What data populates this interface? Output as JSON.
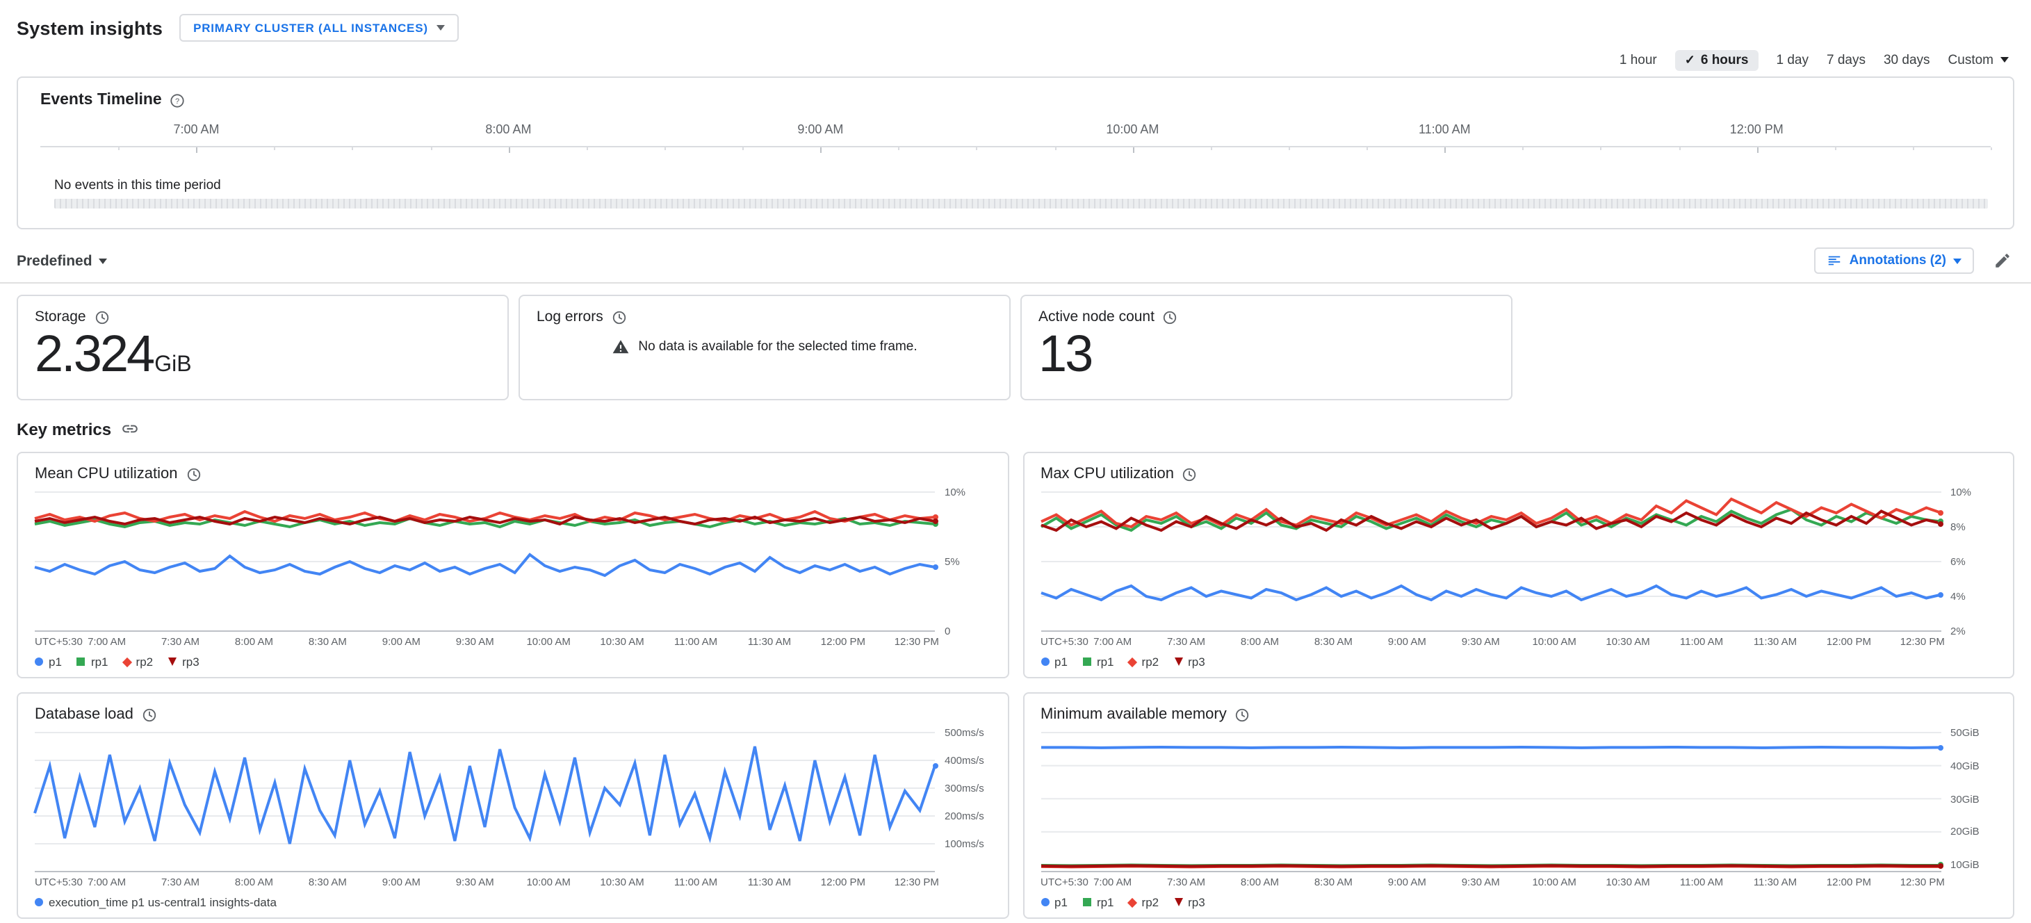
{
  "header": {
    "title": "System insights",
    "scope_button_label": "PRIMARY CLUSTER (ALL INSTANCES)"
  },
  "time_range": {
    "options": [
      {
        "label": "1 hour",
        "selected": false
      },
      {
        "label": "6 hours",
        "selected": true
      },
      {
        "label": "1 day",
        "selected": false
      },
      {
        "label": "7 days",
        "selected": false
      },
      {
        "label": "30 days",
        "selected": false
      }
    ],
    "custom_label": "Custom"
  },
  "icons": {
    "check": "✓",
    "help": "?"
  },
  "events_timeline": {
    "title": "Events Timeline",
    "hours": [
      "7:00 AM",
      "8:00 AM",
      "9:00 AM",
      "10:00 AM",
      "11:00 AM",
      "12:00 PM"
    ],
    "empty_message": "No events in this time period"
  },
  "toolbar": {
    "predefined_label": "Predefined",
    "annotations_label": "Annotations (2)"
  },
  "summary_cards": {
    "storage": {
      "title": "Storage",
      "value": "2.324",
      "unit": "GiB"
    },
    "log_errors": {
      "title": "Log errors",
      "message": "No data is available for the selected time frame."
    },
    "active_nodes": {
      "title": "Active node count",
      "value": "13"
    }
  },
  "key_metrics_title": "Key metrics",
  "xlabels": [
    "UTC+5:30",
    "7:00 AM",
    "7:30 AM",
    "8:00 AM",
    "8:30 AM",
    "9:00 AM",
    "9:30 AM",
    "10:00 AM",
    "10:30 AM",
    "11:00 AM",
    "11:30 AM",
    "12:00 PM",
    "12:30 PM"
  ],
  "charts": [
    {
      "title": "Mean CPU utilization",
      "type": "line",
      "ylim": [
        0,
        10
      ],
      "yticks": [
        {
          "value": 10,
          "label": "10%"
        },
        {
          "value": 5,
          "label": "5%"
        },
        {
          "value": 0,
          "label": "0"
        }
      ],
      "series": [
        {
          "name": "p1",
          "color": "#4285f4",
          "marker": "circle",
          "values": [
            4.6,
            4.3,
            4.8,
            4.4,
            4.1,
            4.7,
            5.0,
            4.4,
            4.2,
            4.6,
            4.9,
            4.3,
            4.5,
            5.4,
            4.6,
            4.2,
            4.4,
            4.8,
            4.3,
            4.1,
            4.6,
            5.0,
            4.5,
            4.2,
            4.7,
            4.4,
            4.9,
            4.3,
            4.6,
            4.1,
            4.5,
            4.8,
            4.2,
            5.5,
            4.7,
            4.3,
            4.6,
            4.4,
            4.0,
            4.7,
            5.1,
            4.4,
            4.2,
            4.8,
            4.5,
            4.1,
            4.6,
            4.9,
            4.3,
            5.3,
            4.6,
            4.2,
            4.7,
            4.4,
            4.8,
            4.3,
            4.6,
            4.1,
            4.5,
            4.8,
            4.6
          ]
        },
        {
          "name": "rp1",
          "color": "#34a853",
          "marker": "square",
          "values": [
            7.7,
            7.9,
            7.6,
            7.8,
            8.0,
            7.7,
            7.5,
            7.8,
            7.9,
            7.6,
            7.8,
            7.7,
            8.0,
            7.8,
            7.6,
            7.9,
            7.7,
            7.5,
            7.8,
            8.0,
            7.7,
            7.9,
            7.6,
            7.8,
            7.7,
            8.1,
            7.8,
            7.6,
            7.9,
            7.7,
            7.8,
            7.5,
            7.9,
            7.7,
            8.0,
            7.8,
            7.6,
            7.9,
            7.7,
            7.8,
            8.0,
            7.6,
            7.8,
            7.9,
            7.7,
            7.5,
            7.8,
            8.0,
            7.7,
            7.9,
            7.6,
            7.8,
            7.7,
            7.9,
            8.1,
            7.7,
            7.8,
            7.6,
            7.9,
            7.8,
            7.7
          ]
        },
        {
          "name": "rp2",
          "color": "#ea4335",
          "marker": "diamond",
          "values": [
            8.1,
            8.4,
            8.0,
            8.2,
            7.9,
            8.3,
            8.5,
            8.1,
            7.9,
            8.2,
            8.4,
            8.0,
            8.3,
            8.1,
            8.6,
            8.2,
            7.9,
            8.3,
            8.1,
            8.4,
            8.0,
            8.2,
            8.5,
            8.1,
            7.9,
            8.3,
            8.0,
            8.4,
            8.2,
            7.9,
            8.1,
            8.5,
            8.2,
            8.0,
            8.3,
            8.1,
            8.4,
            7.9,
            8.2,
            8.0,
            8.5,
            8.3,
            8.0,
            8.2,
            8.4,
            8.1,
            7.9,
            8.3,
            8.1,
            8.4,
            8.0,
            8.2,
            8.6,
            8.1,
            7.9,
            8.2,
            8.4,
            8.0,
            8.3,
            8.1,
            8.2
          ]
        },
        {
          "name": "rp3",
          "color": "#a50e0e",
          "marker": "triangle",
          "values": [
            7.9,
            8.1,
            7.8,
            8.0,
            8.2,
            7.9,
            7.7,
            8.0,
            8.1,
            7.8,
            8.0,
            8.2,
            7.9,
            7.7,
            8.1,
            7.9,
            8.2,
            8.0,
            7.8,
            8.1,
            7.9,
            7.7,
            8.0,
            8.2,
            7.9,
            8.1,
            7.8,
            8.0,
            7.9,
            8.2,
            8.0,
            7.8,
            8.1,
            7.9,
            8.0,
            7.7,
            8.2,
            8.0,
            7.9,
            8.1,
            7.8,
            8.0,
            8.2,
            7.9,
            7.7,
            8.0,
            8.1,
            7.9,
            8.2,
            7.8,
            8.0,
            7.9,
            8.1,
            7.8,
            8.0,
            8.2,
            7.9,
            8.0,
            7.8,
            8.1,
            7.9
          ]
        }
      ]
    },
    {
      "title": "Max CPU utilization",
      "type": "line",
      "ylim": [
        2,
        10
      ],
      "yticks": [
        {
          "value": 10,
          "label": "10%"
        },
        {
          "value": 8,
          "label": "8%"
        },
        {
          "value": 6,
          "label": "6%"
        },
        {
          "value": 4,
          "label": "4%"
        },
        {
          "value": 2,
          "label": "2%"
        }
      ],
      "series": [
        {
          "name": "p1",
          "color": "#4285f4",
          "marker": "circle",
          "values": [
            4.2,
            3.9,
            4.4,
            4.1,
            3.8,
            4.3,
            4.6,
            4.0,
            3.8,
            4.2,
            4.5,
            4.0,
            4.3,
            4.1,
            3.9,
            4.4,
            4.2,
            3.8,
            4.1,
            4.5,
            4.0,
            4.3,
            3.9,
            4.2,
            4.6,
            4.1,
            3.8,
            4.3,
            4.0,
            4.4,
            4.1,
            3.9,
            4.5,
            4.2,
            4.0,
            4.3,
            3.8,
            4.1,
            4.4,
            4.0,
            4.2,
            4.6,
            4.1,
            3.9,
            4.3,
            4.0,
            4.2,
            4.5,
            3.9,
            4.1,
            4.4,
            4.0,
            4.3,
            4.1,
            3.9,
            4.2,
            4.5,
            4.0,
            4.2,
            3.9,
            4.1
          ]
        },
        {
          "name": "rp1",
          "color": "#34a853",
          "marker": "square",
          "values": [
            8.0,
            8.5,
            7.9,
            8.3,
            8.7,
            8.1,
            7.8,
            8.4,
            8.2,
            8.6,
            8.0,
            8.3,
            7.9,
            8.5,
            8.2,
            8.8,
            8.1,
            7.9,
            8.4,
            8.2,
            8.0,
            8.6,
            8.3,
            7.9,
            8.2,
            8.5,
            8.1,
            8.7,
            8.3,
            8.0,
            8.4,
            8.2,
            8.6,
            8.0,
            8.3,
            8.8,
            8.1,
            8.4,
            8.0,
            8.5,
            8.2,
            8.7,
            8.4,
            8.1,
            8.6,
            8.3,
            8.9,
            8.5,
            8.2,
            8.7,
            9.0,
            8.4,
            8.1,
            8.6,
            8.3,
            8.8,
            8.5,
            8.2,
            8.6,
            8.4,
            8.3
          ]
        },
        {
          "name": "rp2",
          "color": "#ea4335",
          "marker": "diamond",
          "values": [
            8.3,
            8.7,
            8.1,
            8.5,
            8.9,
            8.2,
            8.0,
            8.6,
            8.4,
            8.8,
            8.2,
            8.5,
            8.1,
            8.7,
            8.4,
            9.0,
            8.3,
            8.1,
            8.6,
            8.4,
            8.2,
            8.8,
            8.5,
            8.1,
            8.4,
            8.7,
            8.3,
            8.9,
            8.5,
            8.2,
            8.6,
            8.4,
            8.8,
            8.2,
            8.5,
            9.0,
            8.3,
            8.6,
            8.2,
            8.7,
            8.4,
            9.2,
            8.8,
            9.5,
            9.1,
            8.7,
            9.6,
            9.2,
            8.8,
            9.4,
            9.0,
            8.6,
            9.1,
            8.8,
            9.3,
            8.9,
            8.5,
            9.0,
            8.7,
            9.1,
            8.8
          ]
        },
        {
          "name": "rp3",
          "color": "#a50e0e",
          "marker": "triangle",
          "values": [
            8.1,
            7.8,
            8.4,
            8.0,
            8.3,
            7.9,
            8.5,
            8.1,
            7.8,
            8.3,
            8.0,
            8.6,
            8.2,
            7.9,
            8.4,
            8.1,
            8.5,
            8.0,
            8.2,
            7.8,
            8.4,
            8.1,
            8.6,
            8.2,
            7.9,
            8.3,
            8.0,
            8.5,
            8.1,
            8.4,
            7.9,
            8.2,
            8.6,
            8.0,
            8.3,
            8.1,
            8.5,
            7.9,
            8.2,
            8.4,
            8.0,
            8.6,
            8.3,
            8.8,
            8.4,
            8.1,
            8.7,
            8.3,
            8.0,
            8.5,
            8.2,
            8.8,
            8.4,
            8.1,
            8.6,
            8.2,
            8.9,
            8.5,
            8.1,
            8.4,
            8.2
          ]
        }
      ]
    },
    {
      "title": "Database load",
      "type": "line",
      "ylim": [
        0,
        500
      ],
      "yticks": [
        {
          "value": 500,
          "label": "500ms/s"
        },
        {
          "value": 400,
          "label": "400ms/s"
        },
        {
          "value": 300,
          "label": "300ms/s"
        },
        {
          "value": 200,
          "label": "200ms/s"
        },
        {
          "value": 100,
          "label": "100ms/s"
        }
      ],
      "series": [
        {
          "name": "execution_time p1 us-central1 insights-data",
          "color": "#4285f4",
          "marker": "circle",
          "values": [
            210,
            380,
            120,
            340,
            160,
            420,
            180,
            300,
            110,
            390,
            240,
            140,
            360,
            190,
            410,
            150,
            320,
            100,
            370,
            220,
            130,
            400,
            170,
            290,
            120,
            430,
            200,
            340,
            110,
            380,
            160,
            440,
            230,
            120,
            350,
            180,
            410,
            140,
            300,
            240,
            390,
            130,
            420,
            170,
            280,
            120,
            360,
            200,
            450,
            150,
            310,
            110,
            400,
            180,
            340,
            130,
            420,
            160,
            290,
            220,
            380
          ]
        }
      ]
    },
    {
      "title": "Minimum available memory",
      "type": "line",
      "ylim": [
        8,
        50
      ],
      "yticks": [
        {
          "value": 50,
          "label": "50GiB"
        },
        {
          "value": 40,
          "label": "40GiB"
        },
        {
          "value": 30,
          "label": "30GiB"
        },
        {
          "value": 20,
          "label": "20GiB"
        },
        {
          "value": 10,
          "label": "10GiB"
        }
      ],
      "series": [
        {
          "name": "p1",
          "color": "#4285f4",
          "marker": "circle",
          "values": [
            45.5,
            45.5,
            45.4,
            45.5,
            45.6,
            45.5,
            45.5,
            45.4,
            45.5,
            45.5,
            45.6,
            45.5,
            45.4,
            45.5,
            45.5,
            45.5,
            45.6,
            45.5,
            45.4,
            45.5,
            45.5,
            45.6,
            45.5,
            45.5,
            45.4,
            45.5,
            45.6,
            45.5,
            45.5,
            45.4,
            45.5
          ]
        },
        {
          "name": "rp1",
          "color": "#34a853",
          "marker": "square",
          "values": [
            9.9,
            9.8,
            9.9,
            10.0,
            9.9,
            9.8,
            9.9,
            9.9,
            10.0,
            9.9,
            9.8,
            9.9,
            9.9,
            10.0,
            9.9,
            9.8,
            9.9,
            10.0,
            9.9,
            9.9,
            9.8,
            9.9,
            9.9,
            10.0,
            9.9,
            9.8,
            9.9,
            9.9,
            10.0,
            9.9,
            9.9
          ]
        },
        {
          "name": "rp2",
          "color": "#ea4335",
          "marker": "diamond",
          "values": [
            9.5,
            9.4,
            9.5,
            9.6,
            9.5,
            9.4,
            9.5,
            9.5,
            9.6,
            9.5,
            9.4,
            9.5,
            9.5,
            9.6,
            9.5,
            9.4,
            9.5,
            9.6,
            9.5,
            9.5,
            9.4,
            9.5,
            9.5,
            9.6,
            9.5,
            9.4,
            9.5,
            9.5,
            9.6,
            9.5,
            9.5
          ]
        },
        {
          "name": "rp3",
          "color": "#a50e0e",
          "marker": "triangle",
          "values": [
            9.7,
            9.6,
            9.7,
            9.8,
            9.7,
            9.6,
            9.7,
            9.7,
            9.8,
            9.7,
            9.6,
            9.7,
            9.7,
            9.8,
            9.7,
            9.6,
            9.7,
            9.8,
            9.7,
            9.7,
            9.6,
            9.7,
            9.7,
            9.8,
            9.7,
            9.6,
            9.7,
            9.7,
            9.8,
            9.7,
            9.7
          ]
        }
      ]
    }
  ]
}
